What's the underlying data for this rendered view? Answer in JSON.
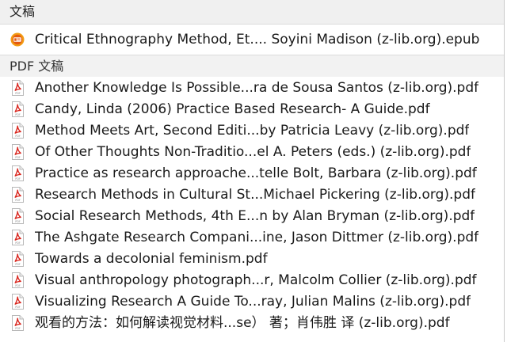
{
  "sections": {
    "documents": {
      "header": "文稿",
      "items": [
        {
          "name": "Critical Ethnography Method, Et.... Soyini Madison (z-lib.org).epub",
          "icon": "epub-icon"
        }
      ]
    },
    "pdf": {
      "header": "PDF 文稿",
      "items": [
        {
          "name": "Another Knowledge Is Possible...ra de Sousa Santos (z-lib.org).pdf",
          "icon": "pdf-file-icon"
        },
        {
          "name": "Candy, Linda (2006) Practice Based Research- A Guide.pdf",
          "icon": "pdf-file-icon"
        },
        {
          "name": "Method Meets Art, Second Editi...by Patricia Leavy (z-lib.org).pdf",
          "icon": "pdf-file-icon"
        },
        {
          "name": "Of Other Thoughts Non-Traditio...el A. Peters (eds.) (z-lib.org).pdf",
          "icon": "pdf-file-icon"
        },
        {
          "name": "Practice as research  approache...telle Bolt, Barbara (z-lib.org).pdf",
          "icon": "pdf-file-icon"
        },
        {
          "name": "Research Methods in Cultural St...Michael Pickering (z-lib.org).pdf",
          "icon": "pdf-file-icon"
        },
        {
          "name": "Social Research Methods, 4th E...n by Alan Bryman (z-lib.org).pdf",
          "icon": "pdf-file-icon"
        },
        {
          "name": "The Ashgate Research Compani...ine, Jason Dittmer (z-lib.org).pdf",
          "icon": "pdf-file-icon"
        },
        {
          "name": "Towards a decolonial feminism.pdf",
          "icon": "pdf-file-icon"
        },
        {
          "name": "Visual anthropology photograph...r, Malcolm Collier (z-lib.org).pdf",
          "icon": "pdf-file-icon"
        },
        {
          "name": "Visualizing Research A Guide To...ray, Julian Malins (z-lib.org).pdf",
          "icon": "pdf-file-icon"
        },
        {
          "name": "观看的方法：如何解读视觉材料...se） 著；肖伟胜 译 (z-lib.org).pdf",
          "icon": "pdf-file-icon"
        }
      ]
    }
  },
  "colors": {
    "header_bg": "#f0f0f0",
    "pdf_red": "#d9251d",
    "epub_orange": "#f29b13",
    "text": "#1a1a1a"
  }
}
